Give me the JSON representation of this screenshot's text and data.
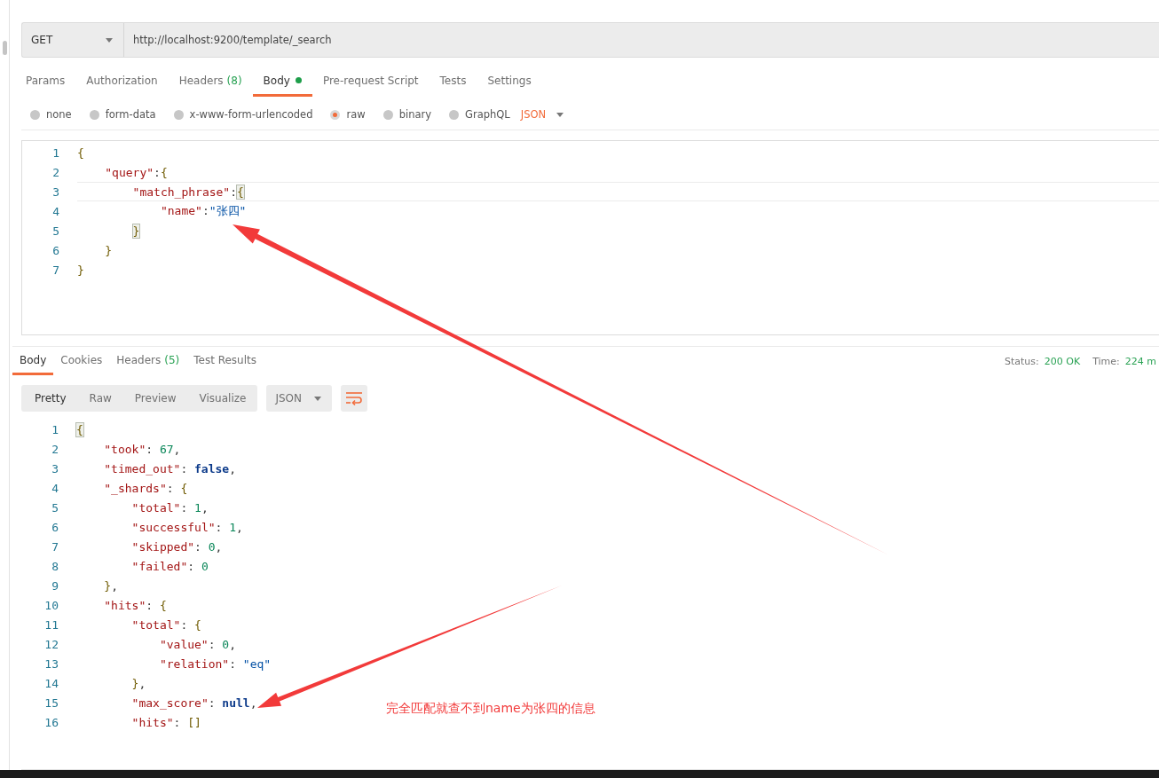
{
  "request": {
    "method": "GET",
    "url": "http://localhost:9200/template/_search"
  },
  "request_tabs": [
    {
      "label": "Params",
      "selected": false,
      "modified": false
    },
    {
      "label": "Authorization",
      "selected": false,
      "modified": false
    },
    {
      "label": "Headers",
      "count": "(8)",
      "selected": false,
      "modified": false
    },
    {
      "label": "Body",
      "selected": true,
      "modified": true
    },
    {
      "label": "Pre-request Script",
      "selected": false,
      "modified": false
    },
    {
      "label": "Tests",
      "selected": false,
      "modified": false
    },
    {
      "label": "Settings",
      "selected": false,
      "modified": false
    }
  ],
  "body_types": [
    {
      "label": "none",
      "selected": false
    },
    {
      "label": "form-data",
      "selected": false
    },
    {
      "label": "x-www-form-urlencoded",
      "selected": false
    },
    {
      "label": "raw",
      "selected": true
    },
    {
      "label": "binary",
      "selected": false
    },
    {
      "label": "GraphQL",
      "selected": false
    }
  ],
  "body_format": "JSON",
  "request_body": {
    "lines": [
      {
        "number": "1",
        "active": false,
        "tokens": [
          {
            "kind": "brace",
            "s": "{"
          }
        ],
        "children": [
          {
            "number": "2",
            "active": false,
            "tokens": [
              {
                "kind": "key",
                "s": "\"query\""
              },
              {
                "kind": "punct",
                "s": ":"
              },
              {
                "kind": "brace",
                "s": "{"
              }
            ],
            "children": [
              {
                "number": "3",
                "active": true,
                "tokens": [
                  {
                    "kind": "key",
                    "s": "\"match_phrase\""
                  },
                  {
                    "kind": "punct",
                    "s": ":"
                  },
                  {
                    "kind": "match",
                    "s": "{"
                  }
                ],
                "children": [
                  {
                    "number": "4",
                    "active": false,
                    "tokens": [
                      {
                        "kind": "key",
                        "s": "\"name\""
                      },
                      {
                        "kind": "punct",
                        "s": ":"
                      },
                      {
                        "kind": "string",
                        "s": "\"张四\""
                      }
                    ]
                  }
                ]
              },
              {
                "number": "5",
                "active": false,
                "tokens": [
                  {
                    "kind": "match",
                    "s": "}"
                  }
                ]
              }
            ]
          },
          {
            "number": "6",
            "active": false,
            "tokens": [
              {
                "kind": "brace",
                "s": "}"
              }
            ]
          }
        ]
      },
      {
        "number": "7",
        "active": false,
        "tokens": [
          {
            "kind": "brace",
            "s": "}"
          }
        ]
      }
    ]
  },
  "response_tabs": [
    {
      "label": "Body",
      "selected": true
    },
    {
      "label": "Cookies",
      "selected": false
    },
    {
      "label": "Headers",
      "count": "(5)",
      "selected": false
    },
    {
      "label": "Test Results",
      "selected": false
    }
  ],
  "status": {
    "label": "Status:",
    "value": "200 OK"
  },
  "time": {
    "label": "Time:",
    "value": "224 m"
  },
  "view_modes": [
    {
      "label": "Pretty",
      "selected": true
    },
    {
      "label": "Raw",
      "selected": false
    },
    {
      "label": "Preview",
      "selected": false
    },
    {
      "label": "Visualize",
      "selected": false
    }
  ],
  "view_format": "JSON",
  "response_body": {
    "lines": [
      {
        "number": "1",
        "active": false,
        "tokens": [
          {
            "kind": "match",
            "s": "{"
          }
        ],
        "children": [
          {
            "number": "2",
            "active": false,
            "tokens": [
              {
                "kind": "key",
                "s": "\"took\""
              },
              {
                "kind": "punct",
                "s": ": "
              },
              {
                "kind": "number",
                "s": "67"
              },
              {
                "kind": "punct",
                "s": ","
              }
            ]
          },
          {
            "number": "3",
            "active": false,
            "tokens": [
              {
                "kind": "key",
                "s": "\"timed_out\""
              },
              {
                "kind": "punct",
                "s": ": "
              },
              {
                "kind": "keyword",
                "s": "false"
              },
              {
                "kind": "punct",
                "s": ","
              }
            ]
          },
          {
            "number": "4",
            "active": false,
            "tokens": [
              {
                "kind": "key",
                "s": "\"_shards\""
              },
              {
                "kind": "punct",
                "s": ": "
              },
              {
                "kind": "brace",
                "s": "{"
              }
            ],
            "children": [
              {
                "number": "5",
                "active": false,
                "tokens": [
                  {
                    "kind": "key",
                    "s": "\"total\""
                  },
                  {
                    "kind": "punct",
                    "s": ": "
                  },
                  {
                    "kind": "number",
                    "s": "1"
                  },
                  {
                    "kind": "punct",
                    "s": ","
                  }
                ]
              },
              {
                "number": "6",
                "active": false,
                "tokens": [
                  {
                    "kind": "key",
                    "s": "\"successful\""
                  },
                  {
                    "kind": "punct",
                    "s": ": "
                  },
                  {
                    "kind": "number",
                    "s": "1"
                  },
                  {
                    "kind": "punct",
                    "s": ","
                  }
                ]
              },
              {
                "number": "7",
                "active": false,
                "tokens": [
                  {
                    "kind": "key",
                    "s": "\"skipped\""
                  },
                  {
                    "kind": "punct",
                    "s": ": "
                  },
                  {
                    "kind": "number",
                    "s": "0"
                  },
                  {
                    "kind": "punct",
                    "s": ","
                  }
                ]
              },
              {
                "number": "8",
                "active": false,
                "tokens": [
                  {
                    "kind": "key",
                    "s": "\"failed\""
                  },
                  {
                    "kind": "punct",
                    "s": ": "
                  },
                  {
                    "kind": "number",
                    "s": "0"
                  }
                ]
              }
            ]
          },
          {
            "number": "9",
            "active": false,
            "tokens": [
              {
                "kind": "brace",
                "s": "}"
              },
              {
                "kind": "punct",
                "s": ","
              }
            ]
          },
          {
            "number": "10",
            "active": false,
            "tokens": [
              {
                "kind": "key",
                "s": "\"hits\""
              },
              {
                "kind": "punct",
                "s": ": "
              },
              {
                "kind": "brace",
                "s": "{"
              }
            ],
            "children": [
              {
                "number": "11",
                "active": false,
                "tokens": [
                  {
                    "kind": "key",
                    "s": "\"total\""
                  },
                  {
                    "kind": "punct",
                    "s": ": "
                  },
                  {
                    "kind": "brace",
                    "s": "{"
                  }
                ],
                "children": [
                  {
                    "number": "12",
                    "active": false,
                    "tokens": [
                      {
                        "kind": "key",
                        "s": "\"value\""
                      },
                      {
                        "kind": "punct",
                        "s": ": "
                      },
                      {
                        "kind": "number",
                        "s": "0"
                      },
                      {
                        "kind": "punct",
                        "s": ","
                      }
                    ]
                  },
                  {
                    "number": "13",
                    "active": false,
                    "tokens": [
                      {
                        "kind": "key",
                        "s": "\"relation\""
                      },
                      {
                        "kind": "punct",
                        "s": ": "
                      },
                      {
                        "kind": "string",
                        "s": "\"eq\""
                      }
                    ]
                  }
                ]
              },
              {
                "number": "14",
                "active": false,
                "tokens": [
                  {
                    "kind": "brace",
                    "s": "}"
                  },
                  {
                    "kind": "punct",
                    "s": ","
                  }
                ]
              },
              {
                "number": "15",
                "active": false,
                "tokens": [
                  {
                    "kind": "key",
                    "s": "\"max_score\""
                  },
                  {
                    "kind": "punct",
                    "s": ": "
                  },
                  {
                    "kind": "keyword",
                    "s": "null"
                  },
                  {
                    "kind": "punct",
                    "s": ","
                  }
                ]
              },
              {
                "number": "16",
                "active": false,
                "tokens": [
                  {
                    "kind": "key",
                    "s": "\"hits\""
                  },
                  {
                    "kind": "punct",
                    "s": ": "
                  },
                  {
                    "kind": "brace",
                    "s": "[]"
                  }
                ]
              }
            ]
          }
        ]
      }
    ]
  },
  "annotation": {
    "text": "完全匹配就查不到name为张四的信息"
  }
}
